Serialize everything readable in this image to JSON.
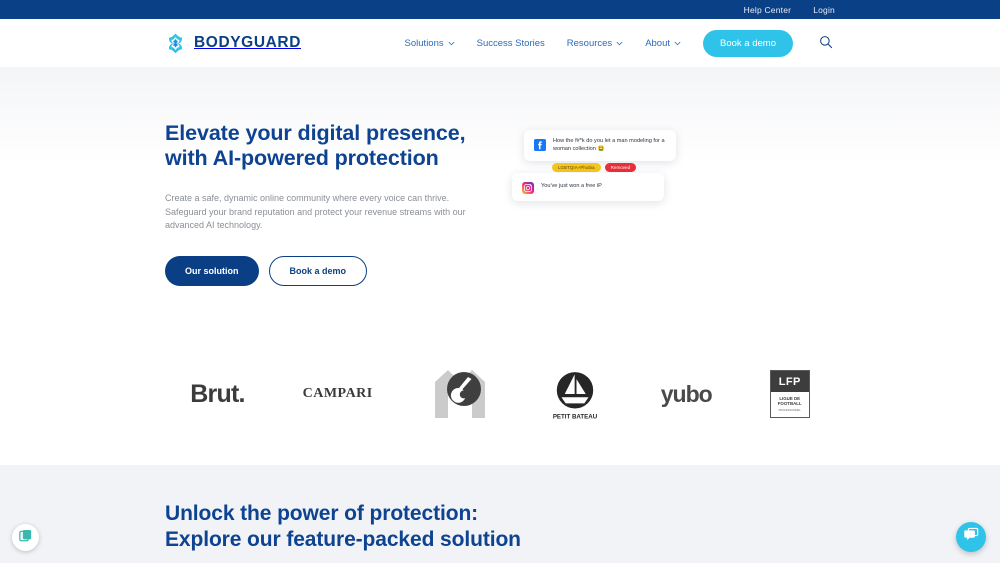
{
  "topbar": {
    "links": [
      {
        "label": "Help Center",
        "name": "help-center-link"
      },
      {
        "label": "Login",
        "name": "login-link"
      }
    ],
    "bg_color": "#0a4085"
  },
  "header": {
    "logo_text": "BODYGUARD",
    "logo_icon": "bodyguard-pinwheel-icon",
    "nav": [
      {
        "label": "Solutions",
        "has_chevron": true
      },
      {
        "label": "Success Stories",
        "has_chevron": false
      },
      {
        "label": "Resources",
        "has_chevron": true
      },
      {
        "label": "About",
        "has_chevron": true
      }
    ],
    "demo_button": "Book a demo",
    "search_icon": "search-icon",
    "accent_color": "#2fc3ea",
    "nav_link_color": "#2a6cb8"
  },
  "hero": {
    "title_line1": "Elevate your digital presence,",
    "title_line2": "with AI-powered protection",
    "paragraph": "Create a safe, dynamic online community where every voice can thrive. Safeguard your brand reputation and protect your revenue streams with our advanced AI technology.",
    "primary_cta": "Our solution",
    "secondary_cta": "Book a demo",
    "title_color": "#0d4391",
    "cards": [
      {
        "platform_icon": "facebook-icon",
        "text": "How the f#*k do you let a man modeling for a woman collection 🤮",
        "badges": [
          {
            "label": "LGBTQIA+Phobia",
            "style": "warn"
          },
          {
            "label": "Removed",
            "style": "danger"
          }
        ]
      },
      {
        "platform_icon": "instagram-icon",
        "text": "You've just won a free iP",
        "badges": []
      }
    ]
  },
  "logos": {
    "items": [
      {
        "name": "brand-logo-brut",
        "label": "Brut."
      },
      {
        "name": "brand-logo-campari",
        "label": "CAMPARI"
      },
      {
        "name": "brand-logo-m6",
        "label": "M6"
      },
      {
        "name": "brand-logo-petit-bateau",
        "label": "PETIT BATEAU"
      },
      {
        "name": "brand-logo-yubo",
        "label": "yubo"
      },
      {
        "name": "brand-logo-lfp",
        "label": "LFP",
        "sub1": "LIGUE DE",
        "sub2": "FOOTBALL",
        "sub3": "PROFESSIONNEL"
      }
    ]
  },
  "bottom_section": {
    "title_line1": "Unlock the power of protection:",
    "title_line2": "Explore our feature-packed solution",
    "bg_color": "#f1f3f6"
  },
  "widgets": {
    "cookie_icon": "cookie-consent-icon",
    "chat_icon": "chat-bubble-icon",
    "chat_bg": "#2fc3ea"
  }
}
